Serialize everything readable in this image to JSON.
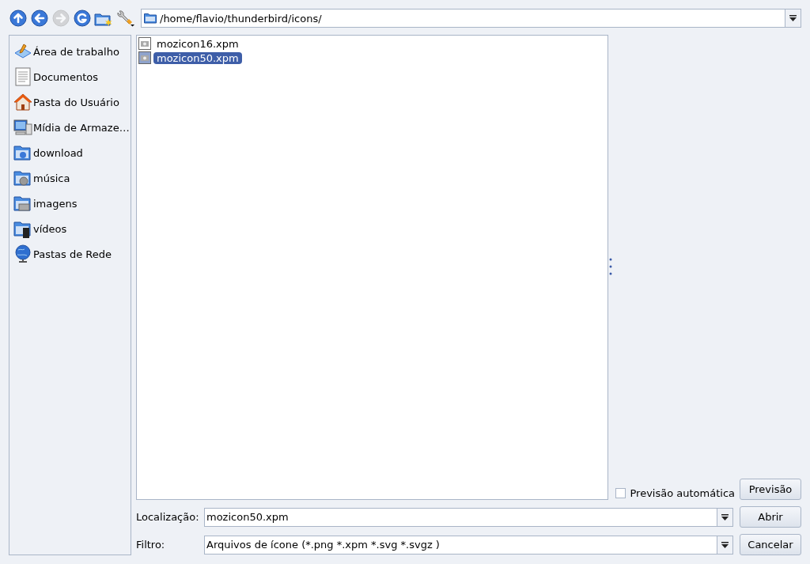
{
  "toolbar": {
    "buttons": [
      {
        "kind": "up",
        "disabled": false
      },
      {
        "kind": "back",
        "disabled": false
      },
      {
        "kind": "forward",
        "disabled": true
      },
      {
        "kind": "reload",
        "disabled": false
      },
      {
        "kind": "new-folder",
        "disabled": false
      },
      {
        "kind": "settings",
        "disabled": false
      }
    ],
    "path": "/home/flavio/thunderbird/icons/"
  },
  "sidebar": {
    "items": [
      {
        "kind": "desktop",
        "label": "Área de trabalho"
      },
      {
        "kind": "document",
        "label": "Documentos"
      },
      {
        "kind": "home",
        "label": "Pasta do Usuário"
      },
      {
        "kind": "computer",
        "label": "Mídia de Armaze…"
      },
      {
        "kind": "folder-download",
        "label": "download"
      },
      {
        "kind": "folder-music",
        "label": "música"
      },
      {
        "kind": "folder-image",
        "label": "imagens"
      },
      {
        "kind": "folder-video",
        "label": "vídeos"
      },
      {
        "kind": "network",
        "label": "Pastas de Rede"
      }
    ]
  },
  "files": [
    {
      "name": "mozicon16.xpm",
      "selected": false
    },
    {
      "name": "mozicon50.xpm",
      "selected": true
    }
  ],
  "preview": {
    "auto_label": "Previsão automática",
    "auto_checked": false,
    "button": "Previsão"
  },
  "location": {
    "label": "Localização:",
    "value": "mozicon50.xpm",
    "button": "Abrir"
  },
  "filter": {
    "label": "Filtro:",
    "value": "Arquivos de ícone (*.png *.xpm *.svg *.svgz )",
    "button": "Cancelar"
  }
}
